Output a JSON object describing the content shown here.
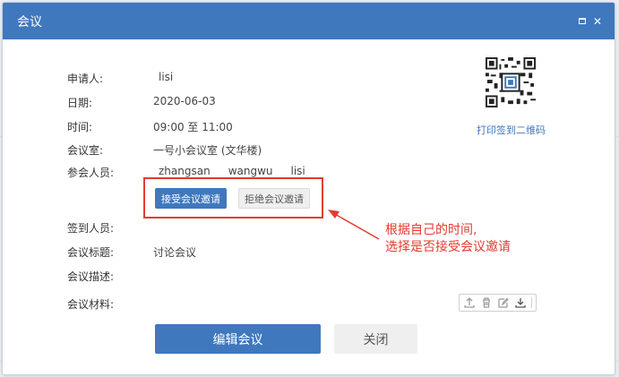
{
  "dialog": {
    "title": "会议",
    "maximize_icon": "maximize-icon",
    "close_icon": "close-icon"
  },
  "fields": {
    "applicant_label": "申请人:",
    "applicant_value": "lisi",
    "date_label": "日期:",
    "date_value": "2020-06-03",
    "time_label": "时间:",
    "time_value": "09:00 至 11:00",
    "room_label": "会议室:",
    "room_value": "一号小会议室 (文华楼)",
    "participants_label": "参会人员:",
    "participants": [
      "zhangsan",
      "wangwu",
      "lisi"
    ],
    "signin_label": "签到人员:",
    "topic_label": "会议标题:",
    "topic_value": "讨论会议",
    "description_label": "会议描述:",
    "materials_label": "会议材料:"
  },
  "invite": {
    "accept_label": "接受会议邀请",
    "reject_label": "拒绝会议邀请"
  },
  "annotation": {
    "line1": "根据自己的时间,",
    "line2": "选择是否接受会议邀请",
    "color": "#e63a32"
  },
  "qr": {
    "link_label": "打印签到二维码"
  },
  "materials_tools": [
    "upload-icon",
    "trash-icon",
    "edit-icon",
    "download-icon"
  ],
  "actions": {
    "edit_label": "编辑会议",
    "close_label": "关闭"
  },
  "colors": {
    "primary": "#3f78bd",
    "annotation": "#e63a32"
  }
}
